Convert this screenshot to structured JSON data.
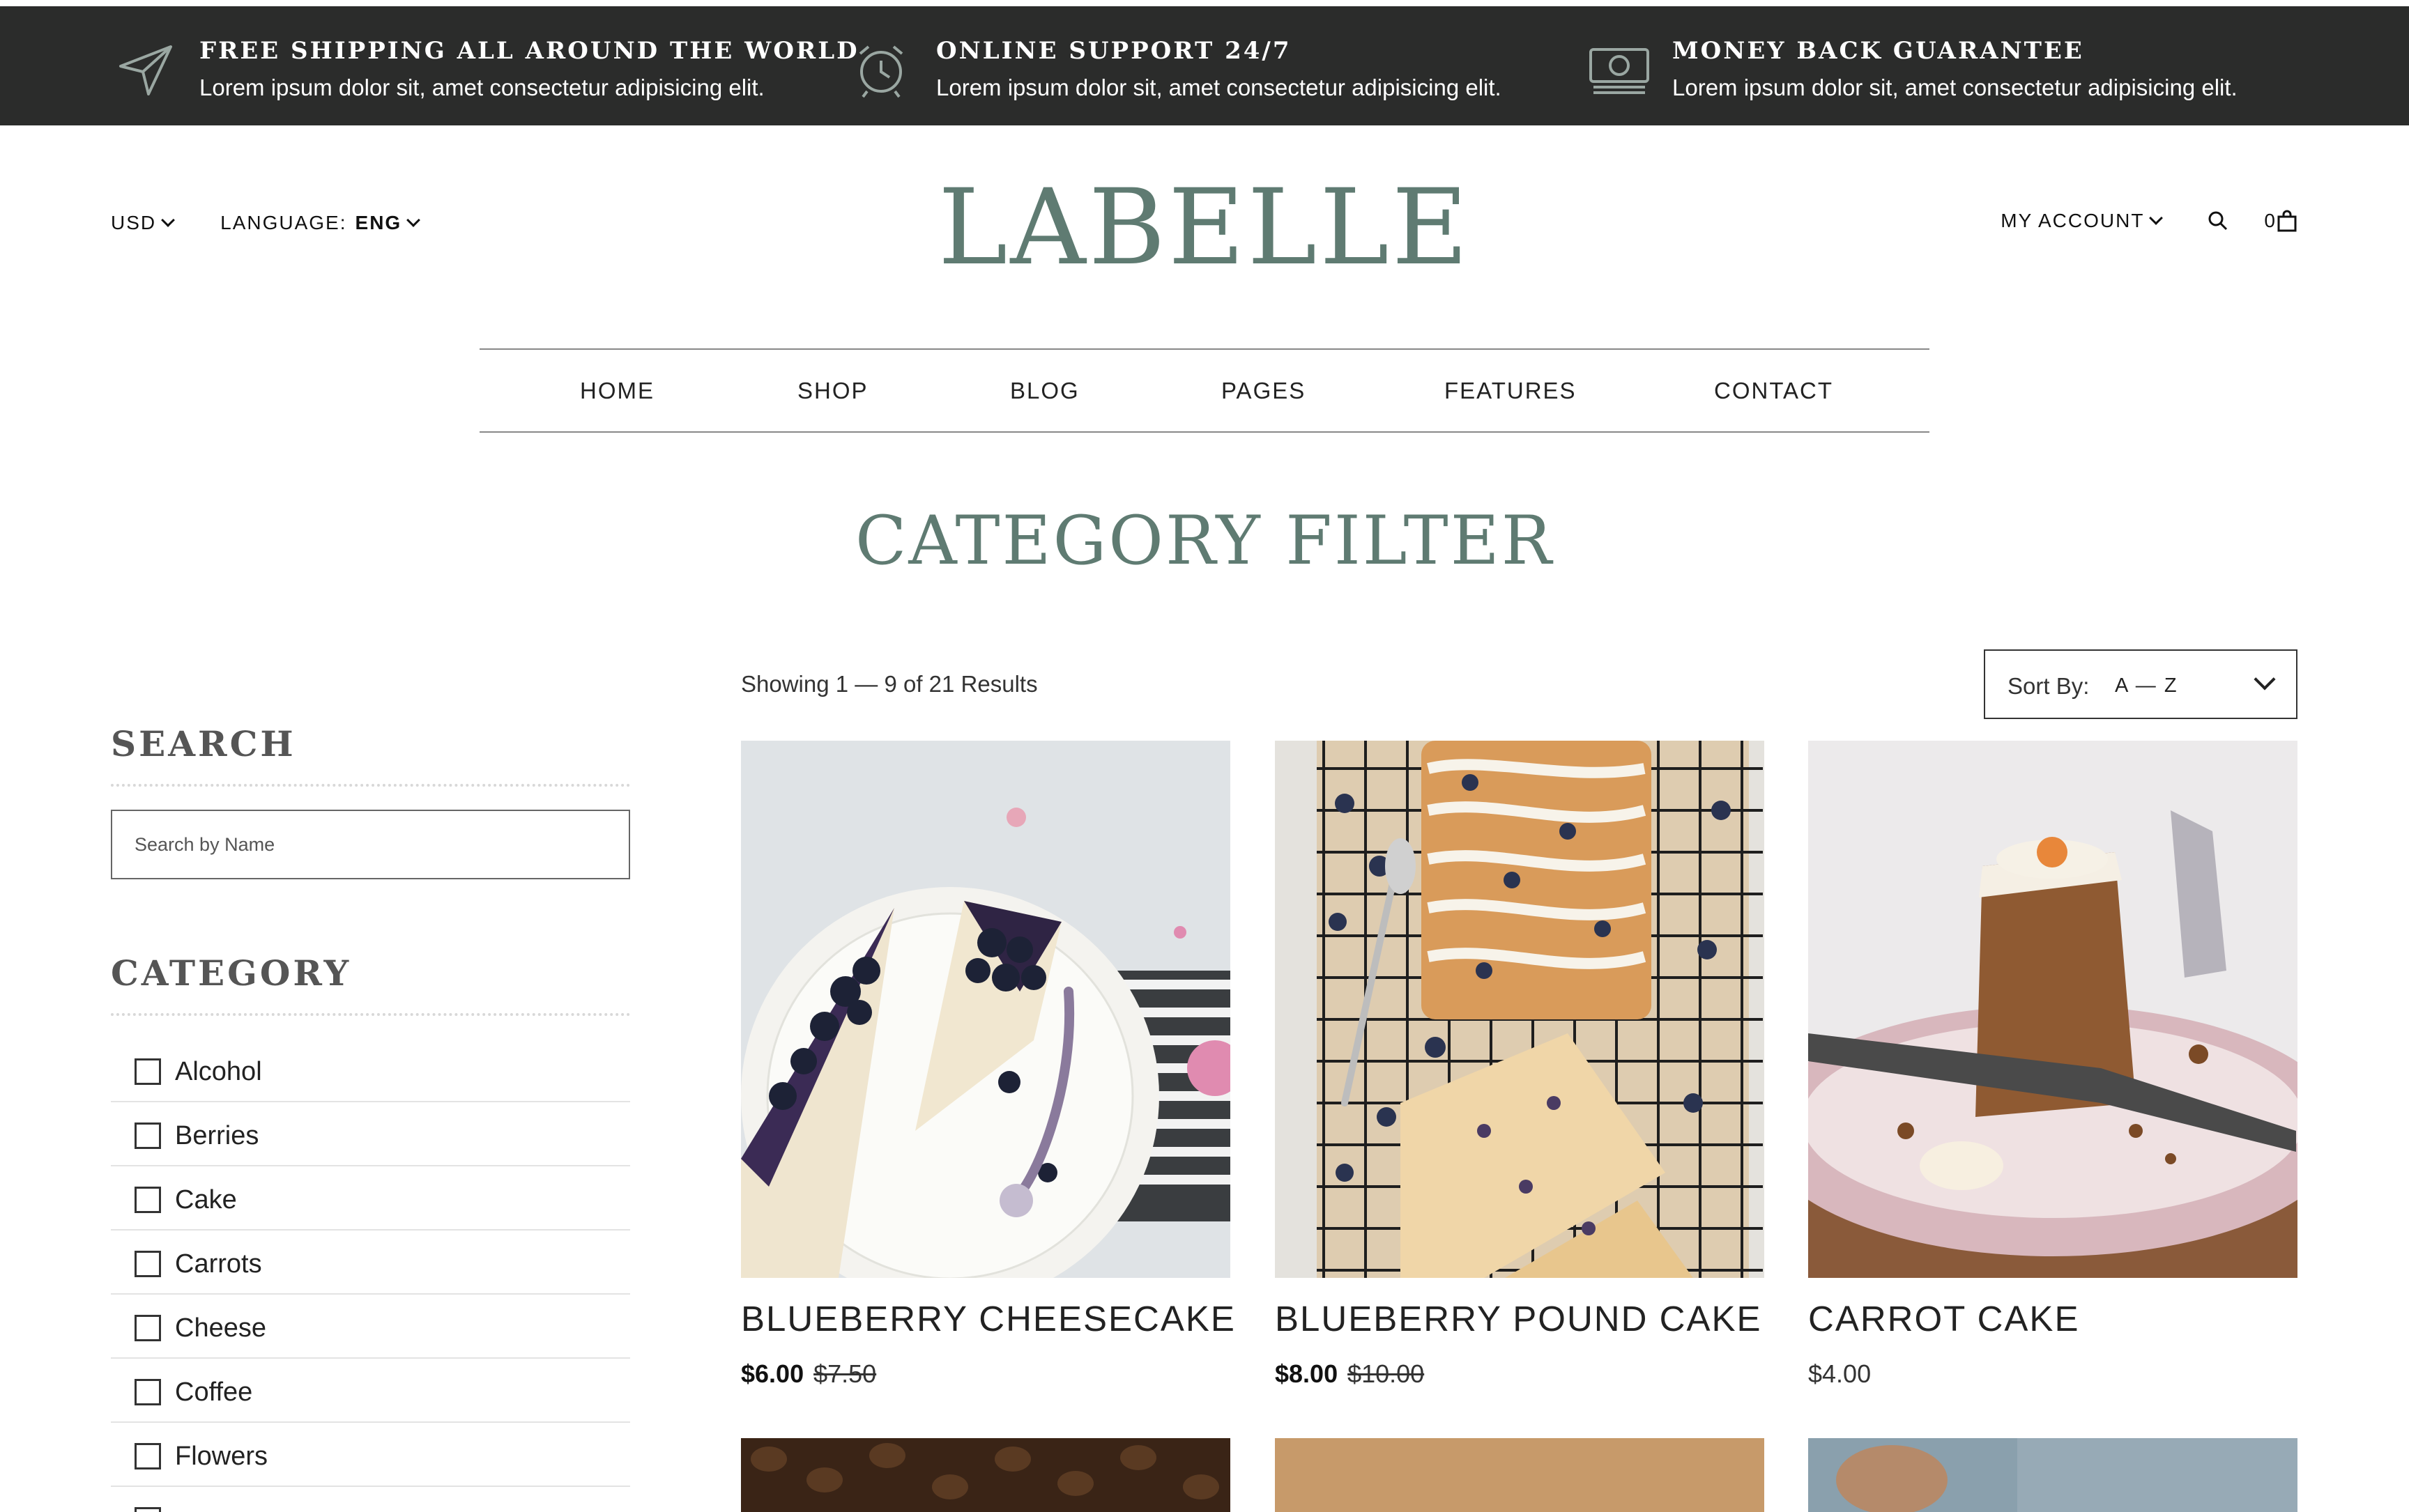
{
  "topbar": {
    "items": [
      {
        "icon": "send-icon",
        "title": "FREE SHIPPING ALL AROUND THE WORLD",
        "text": "Lorem ipsum dolor sit, amet consectetur adipisicing elit."
      },
      {
        "icon": "alarm-clock-icon",
        "title": "ONLINE SUPPORT 24/7",
        "text": "Lorem ipsum dolor sit, amet consectetur adipisicing elit."
      },
      {
        "icon": "money-icon",
        "title": "MONEY BACK GUARANTEE",
        "text": "Lorem ipsum dolor sit, amet consectetur adipisicing elit."
      }
    ]
  },
  "header": {
    "currency": "USD",
    "language_label": "LANGUAGE:",
    "language_value": "ENG",
    "logo": "LABELLE",
    "account": "MY ACCOUNT",
    "cart_count": "0"
  },
  "nav": [
    "HOME",
    "SHOP",
    "BLOG",
    "PAGES",
    "FEATURES",
    "CONTACT"
  ],
  "page_title": "CATEGORY FILTER",
  "sidebar": {
    "search_heading": "SEARCH",
    "search_placeholder": "Search by Name",
    "category_heading": "CATEGORY",
    "categories": [
      "Alcohol",
      "Berries",
      "Cake",
      "Carrots",
      "Cheese",
      "Coffee",
      "Flowers"
    ]
  },
  "results": {
    "showing": "Showing 1 — 9 of 21 Results",
    "sort_label": "Sort By:",
    "sort_value": "A — Z"
  },
  "products": [
    {
      "name": "BLUEBERRY CHEESECAKE",
      "price": "$6.00",
      "old_price": "$7.50"
    },
    {
      "name": "BLUEBERRY POUND CAKE",
      "price": "$8.00",
      "old_price": "$10.00"
    },
    {
      "name": "CARROT CAKE",
      "price": "$4.00",
      "old_price": ""
    }
  ],
  "colors": {
    "topbar_bg": "#2b2c2b",
    "accent": "#5f7b72"
  }
}
